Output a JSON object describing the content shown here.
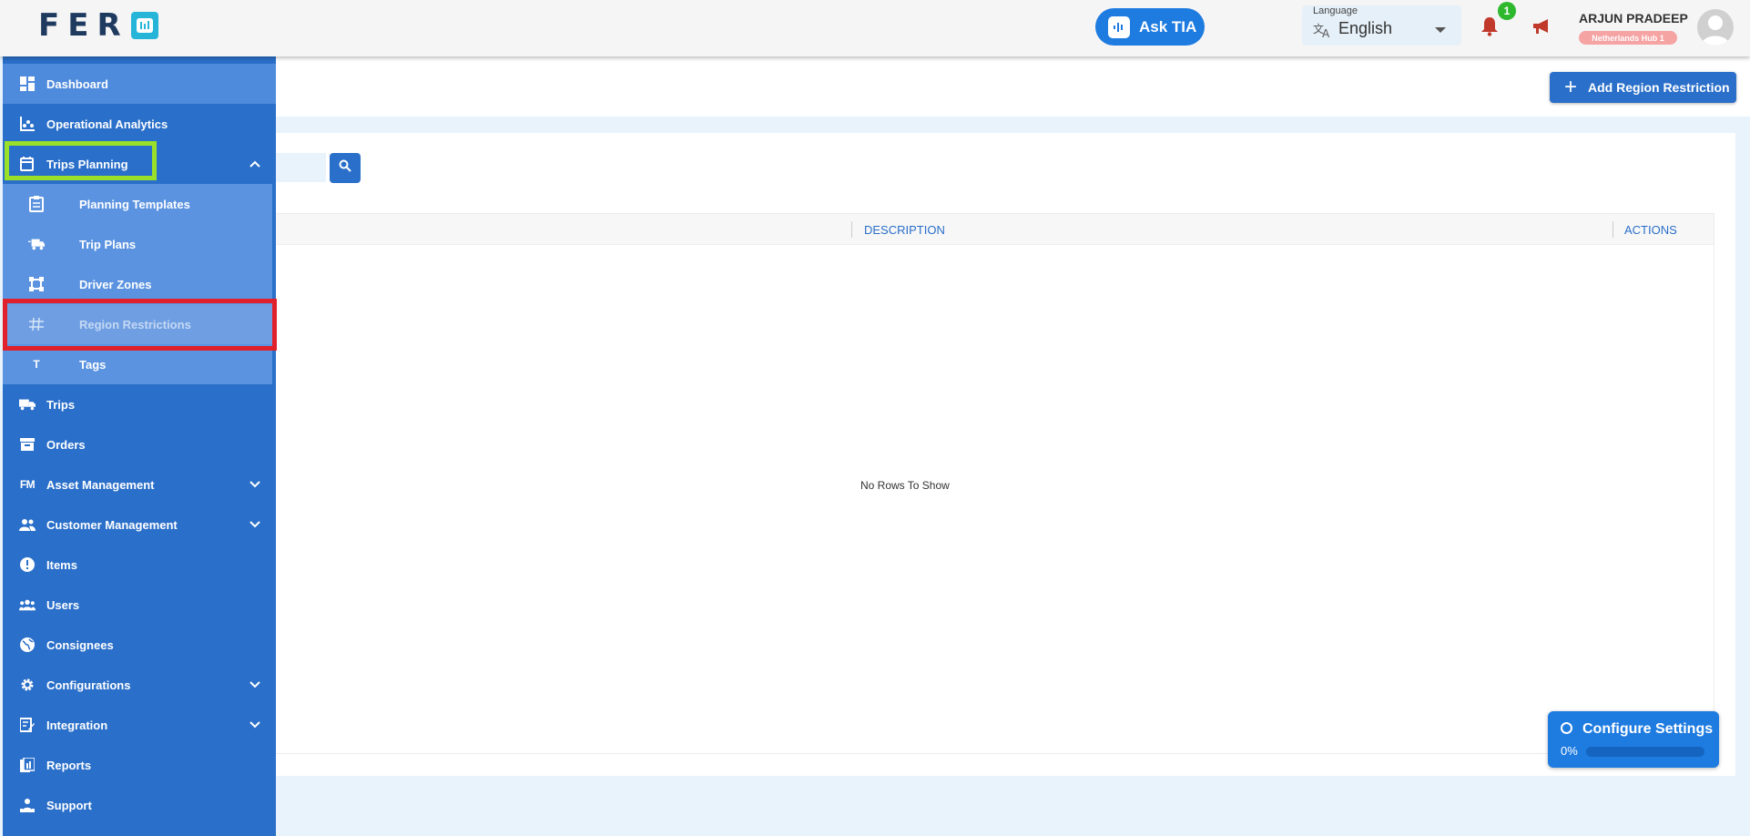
{
  "app": {
    "logo_text": "FER",
    "logo_icon": "chart-box-icon"
  },
  "header": {
    "ask_tia_label": "Ask TIA",
    "language_caption": "Language",
    "language_value": "English",
    "notification_count": "1",
    "user_name": "ARJUN PRADEEP",
    "user_hub": "Netherlands Hub 1"
  },
  "sidebar": {
    "items": [
      {
        "label": "Dashboard",
        "icon": "dashboard-icon"
      },
      {
        "label": "Operational Analytics",
        "icon": "analytics-icon"
      },
      {
        "label": "Trips Planning",
        "icon": "calendar-edit-icon"
      },
      {
        "label": "Planning Templates",
        "icon": "clipboard-icon"
      },
      {
        "label": "Trip Plans",
        "icon": "truck-fast-icon"
      },
      {
        "label": "Driver Zones",
        "icon": "zone-icon"
      },
      {
        "label": "Region Restrictions",
        "icon": "hash-icon"
      },
      {
        "label": "Tags",
        "icon": "t-icon"
      },
      {
        "label": "Trips",
        "icon": "truck-icon"
      },
      {
        "label": "Orders",
        "icon": "archive-icon"
      },
      {
        "label": "Asset Management",
        "icon": "fm-icon"
      },
      {
        "label": "Customer Management",
        "icon": "people-icon"
      },
      {
        "label": "Items",
        "icon": "info-icon"
      },
      {
        "label": "Users",
        "icon": "group-icon"
      },
      {
        "label": "Consignees",
        "icon": "globe-icon"
      },
      {
        "label": "Configurations",
        "icon": "gear-icon"
      },
      {
        "label": "Integration",
        "icon": "edit-note-icon"
      },
      {
        "label": "Reports",
        "icon": "reports-icon"
      },
      {
        "label": "Support",
        "icon": "support-icon"
      }
    ]
  },
  "main": {
    "add_button_label": "Add Region Restriction",
    "search_placeholder": "",
    "columns": [
      "DESCRIPTION",
      "ACTIONS"
    ],
    "empty_text": "No Rows To Show"
  },
  "configure": {
    "title": "Configure Settings",
    "progress_label": "0%",
    "progress": 0
  },
  "colors": {
    "sidebar": "#2a6fc9",
    "submenu": "#5b93e0",
    "accent": "#1e7be0",
    "highlight_green": "#9ae028",
    "highlight_red": "#e0202a"
  }
}
